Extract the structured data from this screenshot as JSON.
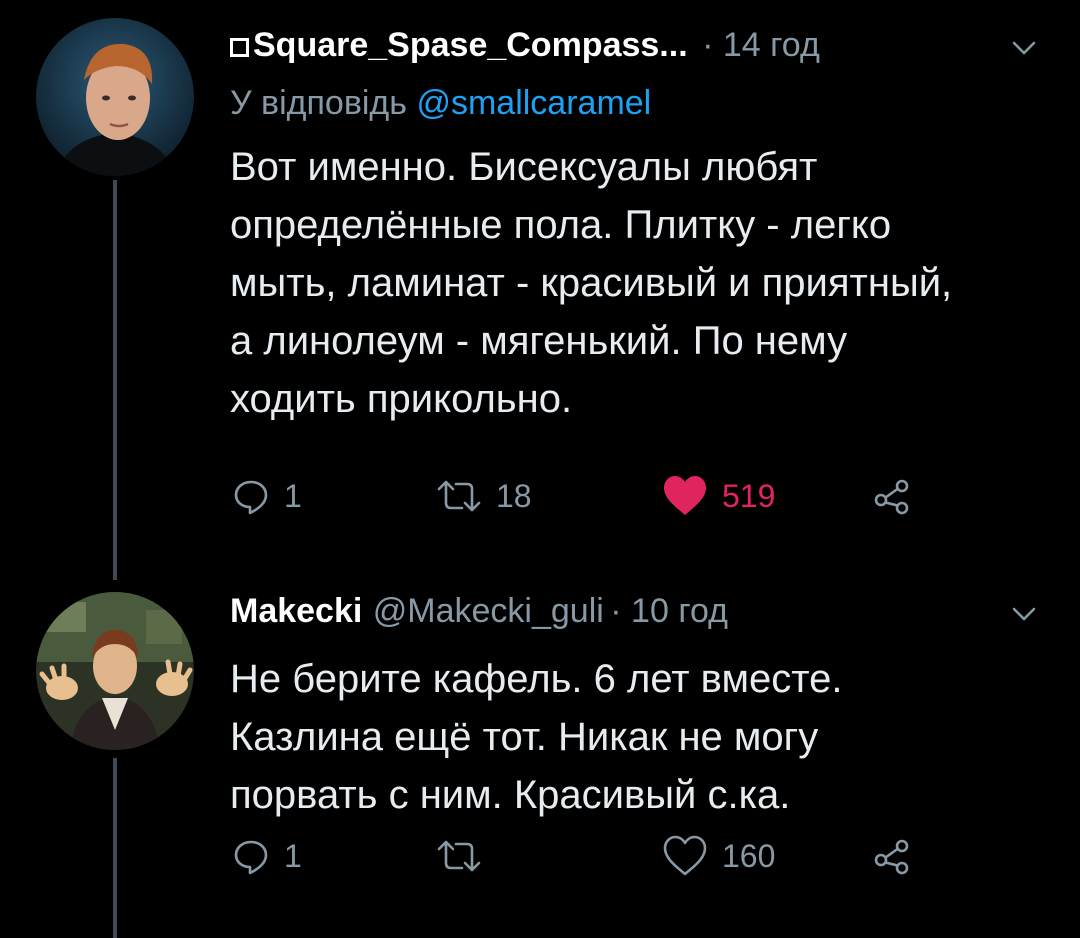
{
  "tweets": [
    {
      "display_name": "Square_Spase_Compass...",
      "time": "· 14 год",
      "reply_prefix": "У відповідь",
      "reply_to": "@smallcaramel",
      "text": "Вот именно. Бисексуалы любят\nопределённые пола. Плитку - легко\nмыть, ламинат - красивый и приятный,\nа линолеум - мягенький. По нему\nходить прикольно.",
      "replies": "1",
      "retweets": "18",
      "likes": "519",
      "liked": true
    },
    {
      "display_name": "Makecki",
      "handle": "@Makecki_guli",
      "time": "· 10 год",
      "text": "Не берите кафель. 6 лет вместе.\nКазлина ещё тот. Никак не могу\nпорвать с ним. Красивый с.ка.",
      "replies": "1",
      "retweets": "",
      "likes": "160",
      "liked": false
    }
  ],
  "colors": {
    "background": "#000000",
    "text": "#e6ecf0",
    "muted": "#8899a6",
    "link": "#1da1f2",
    "like": "#e0245e",
    "thread_line": "#3d4a55"
  },
  "icons": [
    "comment-icon",
    "retweet-icon",
    "heart-icon",
    "share-icon",
    "chevron-down-icon"
  ]
}
